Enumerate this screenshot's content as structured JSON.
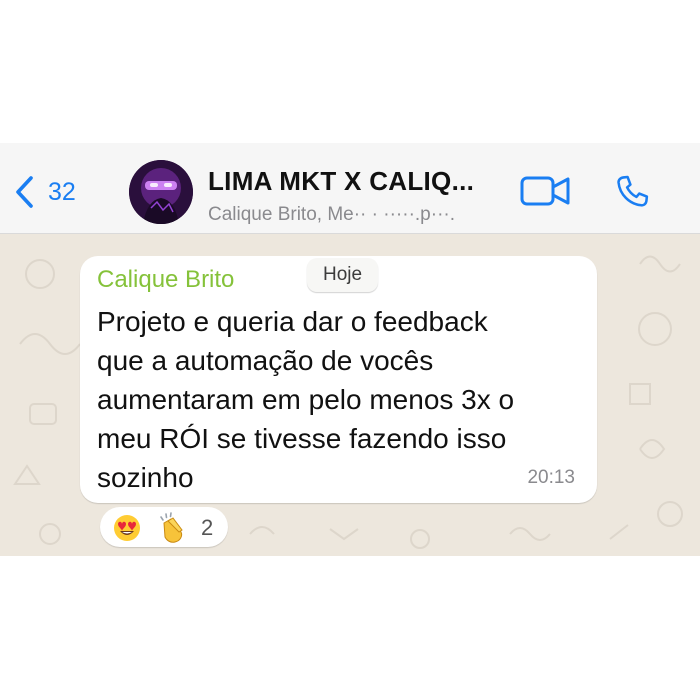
{
  "header": {
    "back_count": "32",
    "title": "LIMA MKT X CALIQ...",
    "subtitle": "Calique Brito, Me·· · ·····.p···.",
    "avatar_icon": "group-avatar",
    "video_icon": "video-camera-icon",
    "phone_icon": "phone-icon",
    "accent_color": "#1a7ef2"
  },
  "chat": {
    "date_chip": "Hoje",
    "message": {
      "sender": "Calique Brito",
      "sender_color": "#85c23a",
      "lines": [
        "Projeto e queria dar o feedback",
        "que a automação de vocês",
        "aumentaram em pelo menos 3x o",
        "meu RÓI se tivesse fazendo isso",
        "sozinho"
      ],
      "time": "20:13"
    },
    "reactions": {
      "emojis": [
        "heart-eyes-emoji",
        "clapping-hands-emoji"
      ],
      "count": "2"
    }
  }
}
